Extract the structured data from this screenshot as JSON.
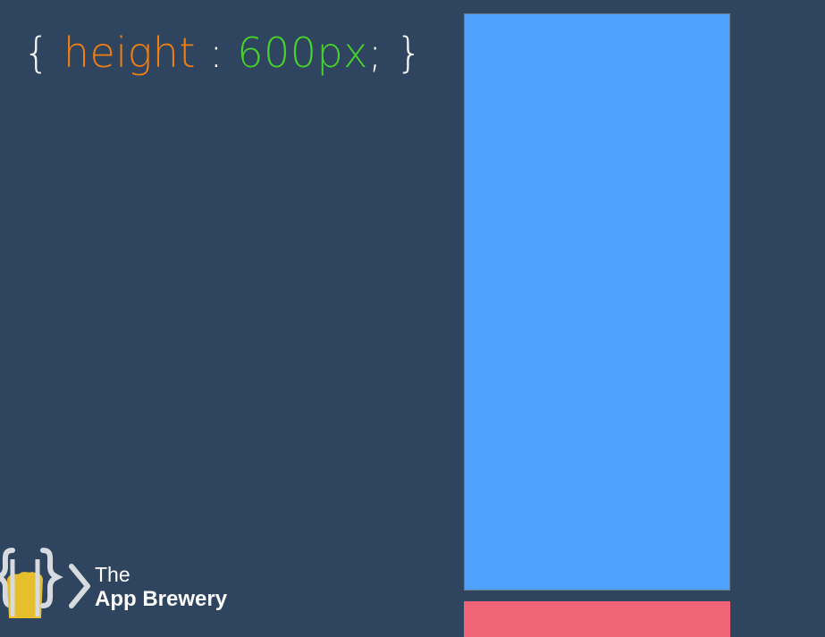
{
  "code": {
    "open_brace": "{",
    "property": "height",
    "colon": ":",
    "value": "600px",
    "semicolon": ";",
    "close_brace": "}"
  },
  "colors": {
    "background": "#2f445e",
    "property": "#f07f12",
    "value": "#46d12d",
    "blue_box": "#4fa1fd",
    "red_box": "#f06478"
  },
  "logo": {
    "line1": "The",
    "line2": "App Brewery",
    "icon": "app-brewery-logo-icon"
  }
}
